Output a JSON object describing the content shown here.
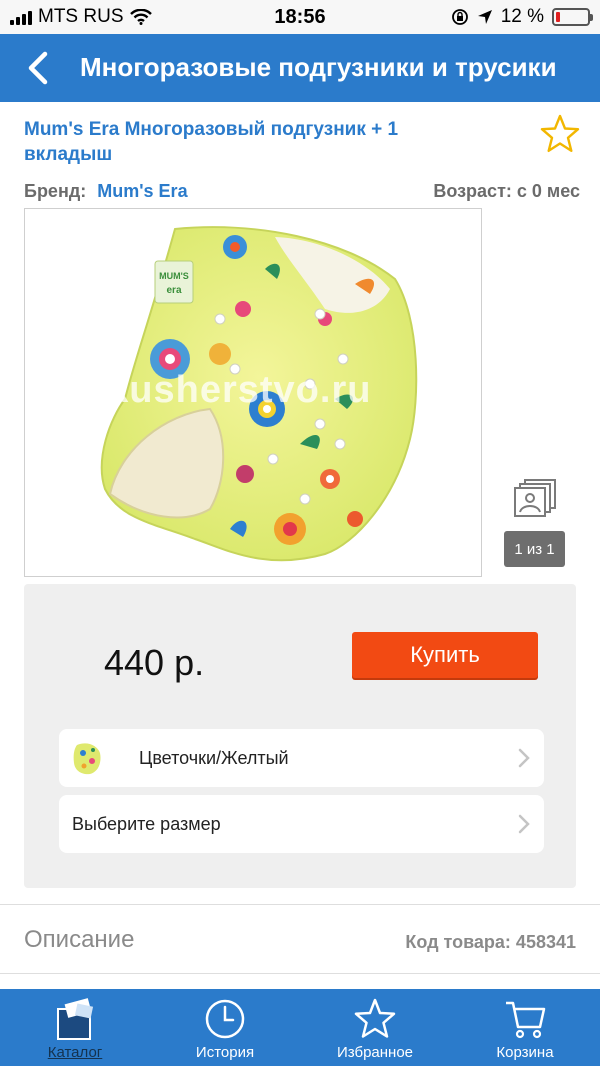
{
  "status_bar": {
    "carrier": "MTS RUS",
    "time": "18:56",
    "battery_text": "12 %",
    "battery_level": 0.12
  },
  "nav": {
    "title": "Многоразовые подгузники и трусики",
    "back_icon": "chevron-left-icon"
  },
  "product": {
    "title": "Mum's Era Многоразовый подгузник + 1 вкладыш",
    "favorite_icon": "star-outline-icon",
    "brand_label": "Бренд:",
    "brand_value": "Mum's Era",
    "age": "Возраст: с 0 мес",
    "image_watermark": "akusherstvo.ru",
    "image_counter": "1 из 1"
  },
  "purchase": {
    "price": "440 р.",
    "buy_label": "Купить",
    "color_option": "Цветочки/Желтый",
    "size_option": "Выберите размер"
  },
  "description": {
    "tab_label": "Описание",
    "sku": "Код товара: 458341"
  },
  "tab_bar": {
    "items": [
      {
        "label": "Каталог",
        "icon": "catalog-icon",
        "active": true
      },
      {
        "label": "История",
        "icon": "clock-icon",
        "active": false
      },
      {
        "label": "Избранное",
        "icon": "star-icon",
        "active": false
      },
      {
        "label": "Корзина",
        "icon": "cart-icon",
        "active": false
      }
    ]
  },
  "colors": {
    "primary": "#2b7bcb",
    "buy_button": "#f24a13",
    "battery_low": "#e02020"
  }
}
